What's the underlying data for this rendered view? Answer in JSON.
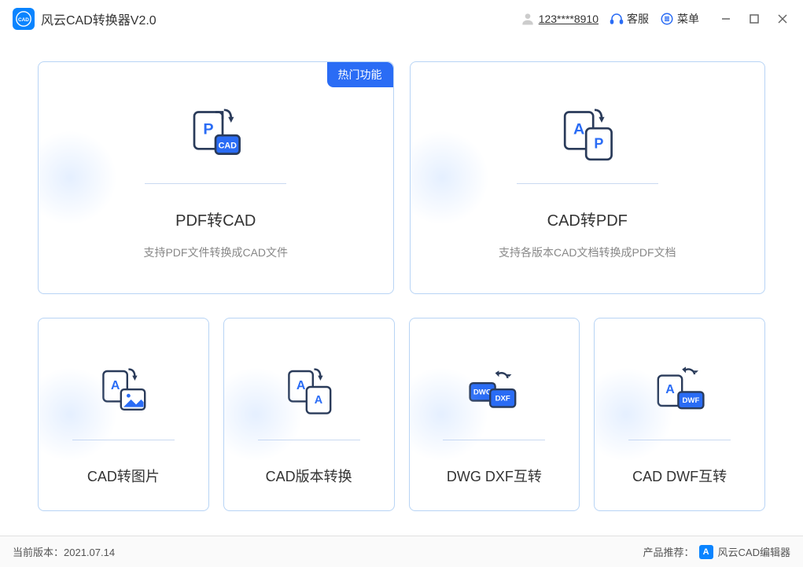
{
  "app": {
    "title": "风云CAD转换器V2.0",
    "logo_text": "CAD"
  },
  "header": {
    "user_id": "123****8910",
    "customer_service": "客服",
    "menu": "菜单"
  },
  "cards": {
    "top": [
      {
        "title": "PDF转CAD",
        "desc": "支持PDF文件转换成CAD文件",
        "badge": "热门功能",
        "icon": "pdf-to-cad"
      },
      {
        "title": "CAD转PDF",
        "desc": "支持各版本CAD文档转换成PDF文档",
        "icon": "cad-to-pdf"
      }
    ],
    "bottom": [
      {
        "title": "CAD转图片",
        "icon": "cad-to-image"
      },
      {
        "title": "CAD版本转换",
        "icon": "cad-version"
      },
      {
        "title": "DWG DXF互转",
        "icon": "dwg-dxf"
      },
      {
        "title": "CAD DWF互转",
        "icon": "cad-dwf"
      }
    ]
  },
  "footer": {
    "version_label": "当前版本：",
    "version": "2021.07.14",
    "recommend_label": "产品推荐：",
    "recommend_product": "风云CAD编辑器",
    "recommend_logo": "A"
  },
  "colors": {
    "accent": "#2a6cf5",
    "border": "#b8d4f5"
  }
}
